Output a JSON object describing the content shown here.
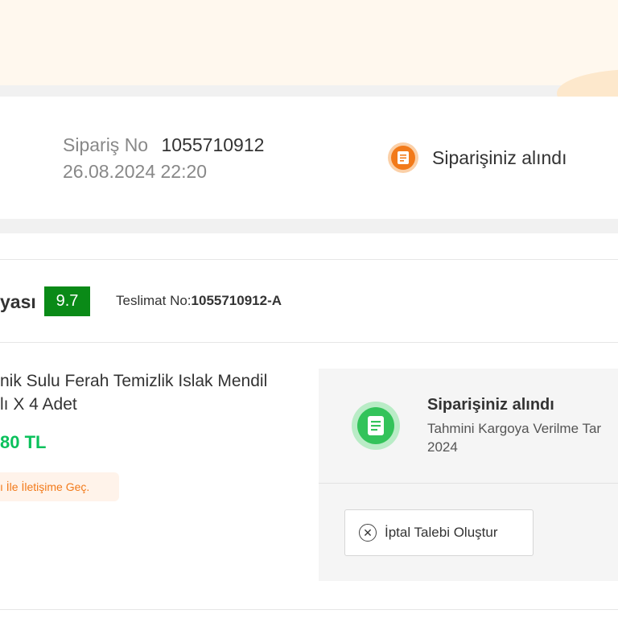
{
  "colors": {
    "accent_orange": "#f27a1a",
    "score_green": "#0a8a17",
    "price_green": "#0bc15c",
    "status_green": "#33c35a"
  },
  "order": {
    "number_label": "Sipariş No",
    "number": "1055710912",
    "date": "26.08.2024 22:20",
    "status_icon": "receipt-icon",
    "status": "Siparişiniz alındı"
  },
  "delivery": {
    "seller_name_fragment": "yası",
    "seller_score": "9.7",
    "delivery_no_label": "Teslimat No:",
    "delivery_no": "1055710912-A"
  },
  "product": {
    "name": "nik Sulu Ferah Temizlik Islak Mendil\nlı X 4 Adet",
    "price": "80 TL",
    "contact_link": "ı İle İletişime Geç."
  },
  "status_panel": {
    "icon": "receipt-icon",
    "title": "Siparişiniz alındı",
    "estimate": "Tahmini Kargoya Verilme Tar\n2024",
    "cancel_icon": "close-circle-icon",
    "cancel_label": "İptal Talebi Oluştur"
  }
}
